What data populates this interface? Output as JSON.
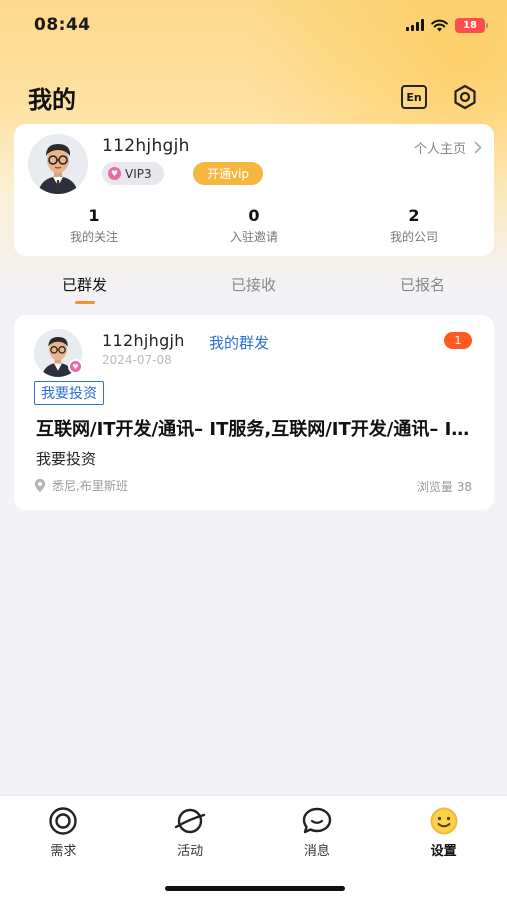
{
  "status_bar": {
    "time": "08:44",
    "battery": "18"
  },
  "header": {
    "title": "我的",
    "lang_label": "En"
  },
  "profile": {
    "username": "112hjhgjh",
    "vip_level": "VIP3",
    "open_vip": "开通vip",
    "home_link": "个人主页",
    "stats": [
      {
        "value": "1",
        "label": "我的关注"
      },
      {
        "value": "0",
        "label": "入驻邀请"
      },
      {
        "value": "2",
        "label": "我的公司"
      }
    ]
  },
  "tabs": [
    {
      "label": "已群发",
      "active": true
    },
    {
      "label": "已接收",
      "active": false
    },
    {
      "label": "已报名",
      "active": false
    }
  ],
  "post": {
    "username": "112hjhgjh",
    "tag_inline": "我的群发",
    "date": "2024-07-08",
    "badge_count": "1",
    "tag_box": "我要投资",
    "title": "互联网/IT开发/通讯– IT服务,互联网/IT开发/通讯– IT服务",
    "desc": "我要投资",
    "location": "悉尼,布里斯班",
    "views": "浏览量 38"
  },
  "bottom_nav": [
    {
      "label": "需求",
      "icon": "target-icon"
    },
    {
      "label": "活动",
      "icon": "planet-icon"
    },
    {
      "label": "消息",
      "icon": "chat-bubble-icon"
    },
    {
      "label": "设置",
      "icon": "smiley-icon",
      "active": true
    }
  ],
  "colors": {
    "accent": "#f5b740",
    "link_blue": "#2b6fd6",
    "badge_red": "#ff5a1f",
    "active_tab_underline": "#f0932b"
  }
}
